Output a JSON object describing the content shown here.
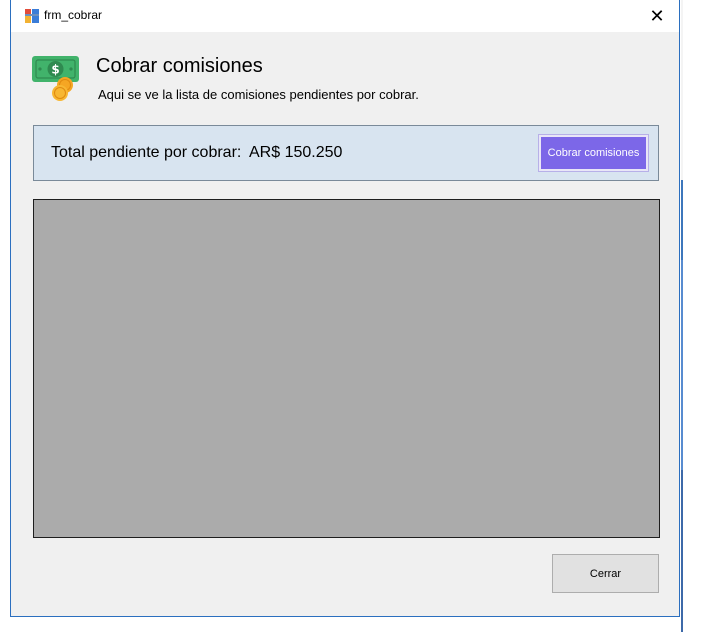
{
  "window": {
    "title": "frm_cobrar",
    "close_glyph": "✕"
  },
  "header": {
    "icon": "money-coins-icon",
    "title": "Cobrar comisiones",
    "subtitle": "Aqui se ve la lista de comisiones pendientes por cobrar."
  },
  "summary": {
    "total_label": "Total pendiente por cobrar:",
    "total_amount": "AR$ 150.250",
    "cobrar_button_label": "Cobrar comisiones"
  },
  "grid": {
    "rows": []
  },
  "footer": {
    "cerrar_button_label": "Cerrar"
  },
  "colors": {
    "accent_button": "#7c67e8",
    "panel_background": "#d8e4f0",
    "grid_background": "#ababab"
  }
}
